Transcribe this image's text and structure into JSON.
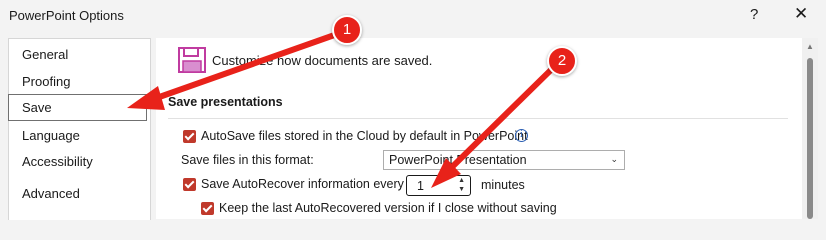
{
  "window": {
    "title": "PowerPoint Options",
    "help": "?",
    "close": "✕"
  },
  "sidebar": {
    "items": [
      {
        "label": "General"
      },
      {
        "label": "Proofing"
      },
      {
        "label": "Save"
      },
      {
        "label": "Language"
      },
      {
        "label": "Accessibility"
      },
      {
        "label": "Advanced"
      }
    ]
  },
  "main": {
    "header": "Customize how documents are saved.",
    "section_title": "Save presentations",
    "autosave_label": "AutoSave files stored in the Cloud by default in PowerPoint",
    "format_label": "Save files in this format:",
    "format_value": "PowerPoint Presentation",
    "autorecover_label": "Save AutoRecover information every",
    "autorecover_minutes": "1",
    "minutes_label": "minutes",
    "keep_label": "Keep the last AutoRecovered version if I close without saving"
  },
  "annotations": {
    "badge1": "1",
    "badge2": "2",
    "color": "#e8221a"
  }
}
